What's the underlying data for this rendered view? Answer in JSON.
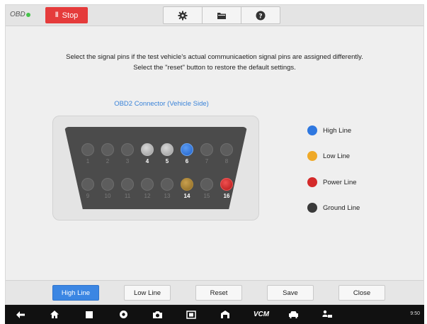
{
  "header": {
    "logo_text": "OBD",
    "stop_label": "Stop",
    "stop_icon": "pause-icon",
    "tools": [
      "gear-icon",
      "folder-icon",
      "help-icon"
    ]
  },
  "instructions": {
    "line1": "Select the signal pins if the test vehicle's actual communicaetion signal pins are assigned differently.",
    "line2": "Select the \"reset\" button to restore the default settings."
  },
  "connector": {
    "title": "OBD2 Connector (Vehicle Side)",
    "top_row": [
      {
        "num": "1",
        "state": "off"
      },
      {
        "num": "2",
        "state": "off"
      },
      {
        "num": "3",
        "state": "off"
      },
      {
        "num": "4",
        "state": "grey"
      },
      {
        "num": "5",
        "state": "grey"
      },
      {
        "num": "6",
        "state": "blue"
      },
      {
        "num": "7",
        "state": "off"
      },
      {
        "num": "8",
        "state": "off"
      }
    ],
    "bottom_row": [
      {
        "num": "9",
        "state": "off"
      },
      {
        "num": "10",
        "state": "off"
      },
      {
        "num": "11",
        "state": "off"
      },
      {
        "num": "12",
        "state": "off"
      },
      {
        "num": "13",
        "state": "off"
      },
      {
        "num": "14",
        "state": "yellow"
      },
      {
        "num": "15",
        "state": "off"
      },
      {
        "num": "16",
        "state": "red"
      }
    ]
  },
  "legend": [
    {
      "label": "High Line",
      "color": "#2f78e0"
    },
    {
      "label": "Low Line",
      "color": "#efa928"
    },
    {
      "label": "Power Line",
      "color": "#d42a2a"
    },
    {
      "label": "Ground Line",
      "color": "#3a3a3a"
    }
  ],
  "buttons": {
    "high_line": "High Line",
    "low_line": "Low Line",
    "reset": "Reset",
    "save": "Save",
    "close": "Close"
  },
  "navbar": {
    "icons": [
      "back-icon",
      "home-icon",
      "recents-icon",
      "browser-icon",
      "camera-icon",
      "screenshot-icon",
      "garage-icon",
      "vcm-icon",
      "car-icon",
      "user-car-icon"
    ],
    "vcm_label": "VCM",
    "status_text": "9:50"
  }
}
